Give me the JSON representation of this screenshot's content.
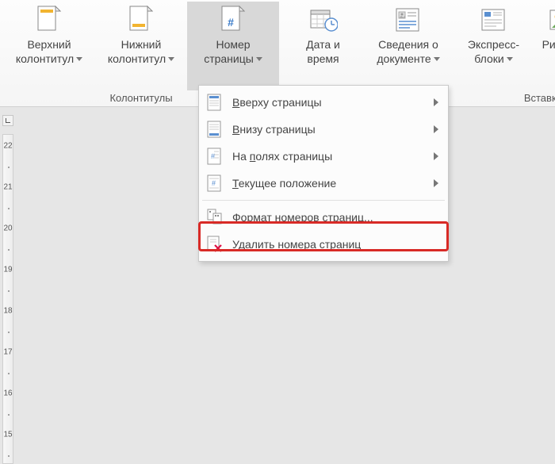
{
  "ribbon": {
    "groups": {
      "headers_footers": {
        "label": "Колонтитулы",
        "header_btn": {
          "line1": "Верхний",
          "line2": "колонтитул"
        },
        "footer_btn": {
          "line1": "Нижний",
          "line2": "колонтитул"
        },
        "page_number_btn": {
          "line1": "Номер",
          "line2": "страницы"
        }
      },
      "insert": {
        "label": "Вставка",
        "date_time_btn": {
          "line1": "Дата и",
          "line2": "время"
        },
        "doc_info_btn": {
          "line1": "Сведения о",
          "line2": "документе"
        },
        "quick_parts_btn": {
          "line1": "Экспресс-",
          "line2": "блоки"
        },
        "pictures_btn": {
          "line1": "Рисунки"
        }
      }
    }
  },
  "page_number_menu": {
    "top_of_page": "верху страницы",
    "top_of_page_u": "В",
    "bottom_of_page_u": "В",
    "bottom_of_page": "низу страницы",
    "page_margins_pre": "На ",
    "page_margins_u": "п",
    "page_margins": "олях страницы",
    "current_position_u": "Т",
    "current_position": "екущее положение",
    "format_u": "Ф",
    "format": "ормат номеров страниц...",
    "remove_u": "У",
    "remove": "далить номера страниц"
  },
  "ruler": {
    "ticks": [
      "22",
      "21",
      "20",
      "19",
      "18",
      "17",
      "16",
      "15"
    ]
  }
}
